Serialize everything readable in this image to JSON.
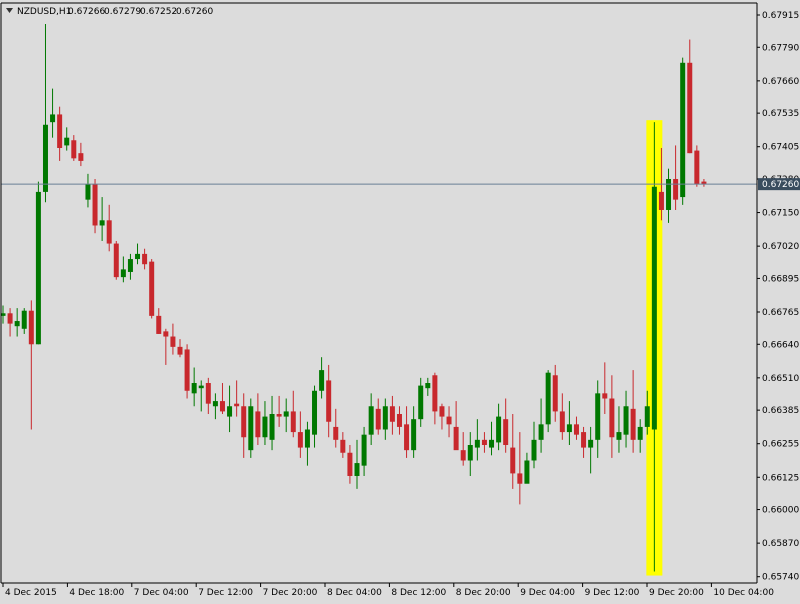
{
  "chart_data": {
    "type": "candlestick",
    "title": "NZDUSD,H1",
    "header_values": [
      "0.67266",
      "0.67279",
      "0.67252",
      "0.67260"
    ],
    "current_price": 0.6726,
    "current_price_label": "0.67260",
    "ylim": [
      0.65735,
      0.67915
    ],
    "y_ticks": [
      "0.67915",
      "0.67790",
      "0.67660",
      "0.67535",
      "0.67405",
      "0.67280",
      "0.67150",
      "0.67020",
      "0.66895",
      "0.66765",
      "0.66640",
      "0.66510",
      "0.66385",
      "0.66255",
      "0.66125",
      "0.66000",
      "0.65870",
      "0.65740"
    ],
    "x_ticks": [
      "4 Dec 2015",
      "4 Dec 18:00",
      "7 Dec 04:00",
      "7 Dec 12:00",
      "7 Dec 20:00",
      "8 Dec 04:00",
      "8 Dec 12:00",
      "8 Dec 20:00",
      "9 Dec 04:00",
      "9 Dec 12:00",
      "9 Dec 20:00",
      "10 Dec 04:00"
    ],
    "highlight_candle_index": 92,
    "colors": {
      "bull": "#007800",
      "bear": "#c8282d",
      "highlight": "#ffff00",
      "current_line": "#6a7f95",
      "background": "#dcdcdc",
      "label_bg": "#3a4d5e"
    },
    "candles": [
      {
        "o": 0.6675,
        "h": 0.6679,
        "l": 0.6672,
        "c": 0.6676
      },
      {
        "o": 0.6676,
        "h": 0.6678,
        "l": 0.6667,
        "c": 0.6672
      },
      {
        "o": 0.6671,
        "h": 0.6678,
        "l": 0.6667,
        "c": 0.6673
      },
      {
        "o": 0.667,
        "h": 0.6678,
        "l": 0.6668,
        "c": 0.6677
      },
      {
        "o": 0.6677,
        "h": 0.6681,
        "l": 0.6631,
        "c": 0.6664
      },
      {
        "o": 0.6664,
        "h": 0.6727,
        "l": 0.6664,
        "c": 0.6723
      },
      {
        "o": 0.6723,
        "h": 0.6788,
        "l": 0.6719,
        "c": 0.6749
      },
      {
        "o": 0.675,
        "h": 0.6763,
        "l": 0.6744,
        "c": 0.6753
      },
      {
        "o": 0.6753,
        "h": 0.6756,
        "l": 0.6735,
        "c": 0.674
      },
      {
        "o": 0.6741,
        "h": 0.6748,
        "l": 0.6739,
        "c": 0.6744
      },
      {
        "o": 0.6743,
        "h": 0.6745,
        "l": 0.6735,
        "c": 0.6736
      },
      {
        "o": 0.6738,
        "h": 0.6742,
        "l": 0.6733,
        "c": 0.6735
      },
      {
        "o": 0.672,
        "h": 0.673,
        "l": 0.6717,
        "c": 0.6726
      },
      {
        "o": 0.6726,
        "h": 0.6728,
        "l": 0.6707,
        "c": 0.671
      },
      {
        "o": 0.671,
        "h": 0.6721,
        "l": 0.6704,
        "c": 0.6712
      },
      {
        "o": 0.6712,
        "h": 0.6718,
        "l": 0.67,
        "c": 0.6703
      },
      {
        "o": 0.6703,
        "h": 0.6704,
        "l": 0.6689,
        "c": 0.669
      },
      {
        "o": 0.669,
        "h": 0.6698,
        "l": 0.6688,
        "c": 0.6693
      },
      {
        "o": 0.6692,
        "h": 0.6699,
        "l": 0.6689,
        "c": 0.6697
      },
      {
        "o": 0.6697,
        "h": 0.6703,
        "l": 0.6695,
        "c": 0.6699
      },
      {
        "o": 0.6699,
        "h": 0.6701,
        "l": 0.6693,
        "c": 0.6695
      },
      {
        "o": 0.6696,
        "h": 0.6697,
        "l": 0.6674,
        "c": 0.6675
      },
      {
        "o": 0.6675,
        "h": 0.6678,
        "l": 0.6668,
        "c": 0.6668
      },
      {
        "o": 0.6669,
        "h": 0.667,
        "l": 0.6656,
        "c": 0.6667
      },
      {
        "o": 0.6667,
        "h": 0.6672,
        "l": 0.666,
        "c": 0.6663
      },
      {
        "o": 0.6663,
        "h": 0.6666,
        "l": 0.6659,
        "c": 0.666
      },
      {
        "o": 0.6662,
        "h": 0.6664,
        "l": 0.6643,
        "c": 0.6646
      },
      {
        "o": 0.6645,
        "h": 0.6655,
        "l": 0.664,
        "c": 0.6649
      },
      {
        "o": 0.6647,
        "h": 0.665,
        "l": 0.6638,
        "c": 0.6648
      },
      {
        "o": 0.6649,
        "h": 0.6651,
        "l": 0.6637,
        "c": 0.6641
      },
      {
        "o": 0.664,
        "h": 0.6645,
        "l": 0.6635,
        "c": 0.6642
      },
      {
        "o": 0.6642,
        "h": 0.6649,
        "l": 0.6637,
        "c": 0.6638
      },
      {
        "o": 0.6636,
        "h": 0.6648,
        "l": 0.663,
        "c": 0.664
      },
      {
        "o": 0.6641,
        "h": 0.665,
        "l": 0.6636,
        "c": 0.664
      },
      {
        "o": 0.664,
        "h": 0.6645,
        "l": 0.662,
        "c": 0.6628
      },
      {
        "o": 0.6623,
        "h": 0.6643,
        "l": 0.662,
        "c": 0.664
      },
      {
        "o": 0.6638,
        "h": 0.6645,
        "l": 0.6625,
        "c": 0.6628
      },
      {
        "o": 0.6628,
        "h": 0.6642,
        "l": 0.6625,
        "c": 0.6636
      },
      {
        "o": 0.6627,
        "h": 0.6644,
        "l": 0.6623,
        "c": 0.6637
      },
      {
        "o": 0.6637,
        "h": 0.6644,
        "l": 0.6632,
        "c": 0.6636
      },
      {
        "o": 0.6636,
        "h": 0.6643,
        "l": 0.663,
        "c": 0.6638
      },
      {
        "o": 0.6638,
        "h": 0.6646,
        "l": 0.6628,
        "c": 0.663
      },
      {
        "o": 0.663,
        "h": 0.6638,
        "l": 0.662,
        "c": 0.6624
      },
      {
        "o": 0.6624,
        "h": 0.6634,
        "l": 0.6617,
        "c": 0.6631
      },
      {
        "o": 0.6629,
        "h": 0.6648,
        "l": 0.6624,
        "c": 0.6646
      },
      {
        "o": 0.6646,
        "h": 0.6659,
        "l": 0.6643,
        "c": 0.6654
      },
      {
        "o": 0.665,
        "h": 0.6656,
        "l": 0.6628,
        "c": 0.6634
      },
      {
        "o": 0.6632,
        "h": 0.6639,
        "l": 0.6624,
        "c": 0.6627
      },
      {
        "o": 0.6627,
        "h": 0.663,
        "l": 0.662,
        "c": 0.6622
      },
      {
        "o": 0.6622,
        "h": 0.6625,
        "l": 0.661,
        "c": 0.6613
      },
      {
        "o": 0.6613,
        "h": 0.6627,
        "l": 0.6608,
        "c": 0.6618
      },
      {
        "o": 0.6617,
        "h": 0.6632,
        "l": 0.6613,
        "c": 0.6629
      },
      {
        "o": 0.6629,
        "h": 0.6645,
        "l": 0.6625,
        "c": 0.664
      },
      {
        "o": 0.6639,
        "h": 0.6643,
        "l": 0.6629,
        "c": 0.6631
      },
      {
        "o": 0.6631,
        "h": 0.6643,
        "l": 0.6627,
        "c": 0.664
      },
      {
        "o": 0.664,
        "h": 0.6644,
        "l": 0.6629,
        "c": 0.6634
      },
      {
        "o": 0.6637,
        "h": 0.664,
        "l": 0.6629,
        "c": 0.6632
      },
      {
        "o": 0.6633,
        "h": 0.664,
        "l": 0.662,
        "c": 0.6623
      },
      {
        "o": 0.6623,
        "h": 0.664,
        "l": 0.662,
        "c": 0.6635
      },
      {
        "o": 0.6635,
        "h": 0.6651,
        "l": 0.6632,
        "c": 0.6648
      },
      {
        "o": 0.6647,
        "h": 0.6651,
        "l": 0.6644,
        "c": 0.6649
      },
      {
        "o": 0.6652,
        "h": 0.6653,
        "l": 0.6633,
        "c": 0.6638
      },
      {
        "o": 0.664,
        "h": 0.6641,
        "l": 0.6631,
        "c": 0.6636
      },
      {
        "o": 0.6636,
        "h": 0.664,
        "l": 0.6628,
        "c": 0.6633
      },
      {
        "o": 0.6632,
        "h": 0.6642,
        "l": 0.6628,
        "c": 0.6623
      },
      {
        "o": 0.6623,
        "h": 0.663,
        "l": 0.6617,
        "c": 0.6619
      },
      {
        "o": 0.6619,
        "h": 0.663,
        "l": 0.6613,
        "c": 0.6625
      },
      {
        "o": 0.6624,
        "h": 0.6635,
        "l": 0.6619,
        "c": 0.6627
      },
      {
        "o": 0.6627,
        "h": 0.663,
        "l": 0.6622,
        "c": 0.6625
      },
      {
        "o": 0.6624,
        "h": 0.6634,
        "l": 0.6621,
        "c": 0.6627
      },
      {
        "o": 0.6626,
        "h": 0.6641,
        "l": 0.6623,
        "c": 0.6636
      },
      {
        "o": 0.6635,
        "h": 0.6643,
        "l": 0.6622,
        "c": 0.6625
      },
      {
        "o": 0.6624,
        "h": 0.6637,
        "l": 0.6608,
        "c": 0.6614
      },
      {
        "o": 0.6614,
        "h": 0.663,
        "l": 0.6602,
        "c": 0.661
      },
      {
        "o": 0.661,
        "h": 0.6622,
        "l": 0.6612,
        "c": 0.6619
      },
      {
        "o": 0.6619,
        "h": 0.6634,
        "l": 0.6616,
        "c": 0.6627
      },
      {
        "o": 0.6627,
        "h": 0.6643,
        "l": 0.6622,
        "c": 0.6633
      },
      {
        "o": 0.6633,
        "h": 0.6654,
        "l": 0.663,
        "c": 0.6653
      },
      {
        "o": 0.6652,
        "h": 0.6656,
        "l": 0.6634,
        "c": 0.6638
      },
      {
        "o": 0.6638,
        "h": 0.6645,
        "l": 0.6627,
        "c": 0.663
      },
      {
        "o": 0.663,
        "h": 0.6642,
        "l": 0.6625,
        "c": 0.6633
      },
      {
        "o": 0.6633,
        "h": 0.6636,
        "l": 0.6627,
        "c": 0.6629
      },
      {
        "o": 0.663,
        "h": 0.6632,
        "l": 0.662,
        "c": 0.6624
      },
      {
        "o": 0.6624,
        "h": 0.6632,
        "l": 0.6614,
        "c": 0.6627
      },
      {
        "o": 0.6627,
        "h": 0.665,
        "l": 0.662,
        "c": 0.6645
      },
      {
        "o": 0.6645,
        "h": 0.6657,
        "l": 0.6637,
        "c": 0.6643
      },
      {
        "o": 0.6643,
        "h": 0.6652,
        "l": 0.662,
        "c": 0.6628
      },
      {
        "o": 0.6627,
        "h": 0.664,
        "l": 0.6622,
        "c": 0.663
      },
      {
        "o": 0.6629,
        "h": 0.6646,
        "l": 0.6624,
        "c": 0.664
      },
      {
        "o": 0.6639,
        "h": 0.6654,
        "l": 0.6622,
        "c": 0.6627
      },
      {
        "o": 0.6627,
        "h": 0.6635,
        "l": 0.6622,
        "c": 0.6632
      },
      {
        "o": 0.6632,
        "h": 0.6646,
        "l": 0.6629,
        "c": 0.664
      },
      {
        "o": 0.6631,
        "h": 0.675,
        "l": 0.6576,
        "c": 0.6725
      },
      {
        "o": 0.6723,
        "h": 0.674,
        "l": 0.6712,
        "c": 0.6716
      },
      {
        "o": 0.6716,
        "h": 0.6732,
        "l": 0.6711,
        "c": 0.6728
      },
      {
        "o": 0.6728,
        "h": 0.6741,
        "l": 0.6716,
        "c": 0.672
      },
      {
        "o": 0.6721,
        "h": 0.6775,
        "l": 0.6718,
        "c": 0.6773
      },
      {
        "o": 0.6773,
        "h": 0.6782,
        "l": 0.6738,
        "c": 0.6738
      },
      {
        "o": 0.6739,
        "h": 0.6741,
        "l": 0.6725,
        "c": 0.6726
      },
      {
        "o": 0.6727,
        "h": 0.6728,
        "l": 0.6725,
        "c": 0.6726
      }
    ]
  }
}
